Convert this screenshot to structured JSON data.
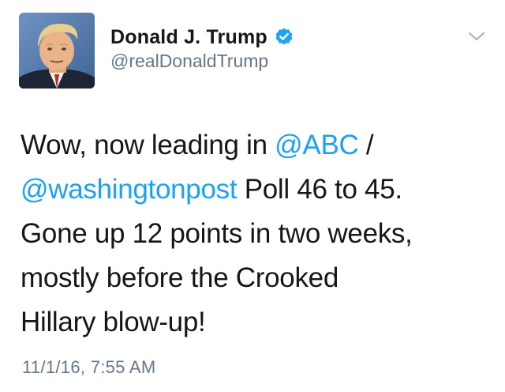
{
  "author": {
    "display_name": "Donald J. Trump",
    "handle": "@realDonaldTrump",
    "verified": true
  },
  "tweet": {
    "line1_a": "Wow, now leading in ",
    "mention_abc": "@ABC",
    "line1_b": " /",
    "mention_wapo": "@washingtonpost",
    "line2_b": " Poll 46 to 45.",
    "line3": "Gone up 12 points in two weeks,",
    "line4": "mostly before the Crooked",
    "line5": "Hillary blow-up!"
  },
  "timestamp": "11/1/16, 7:55 AM",
  "colors": {
    "link": "#1da1f2",
    "text": "#14171a",
    "secondary": "#657786",
    "verified_badge": "#1da1f2"
  },
  "icons": {
    "verified": "verified-badge-icon",
    "menu": "chevron-down-icon"
  }
}
